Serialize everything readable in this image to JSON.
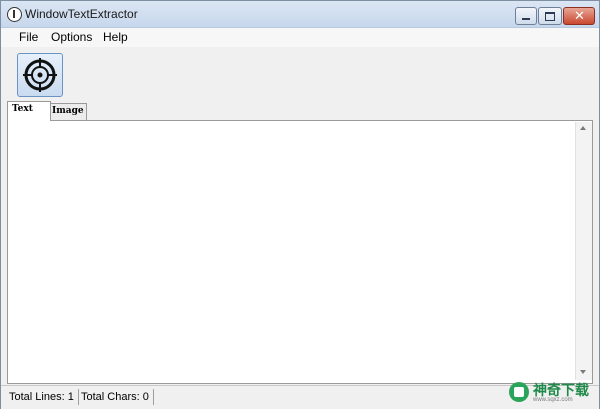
{
  "window": {
    "title": "WindowTextExtractor"
  },
  "menu": {
    "items": [
      "File",
      "Options",
      "Help"
    ]
  },
  "toolbar": {
    "finder_icon": "crosshair-target-icon"
  },
  "tabs": [
    {
      "label": "Text",
      "active": true
    },
    {
      "label": "Image",
      "active": false
    }
  ],
  "content": {
    "text": ""
  },
  "status": {
    "lines": "Total Lines: 1",
    "chars": "Total Chars: 0"
  },
  "watermark": {
    "text": "神奇下载",
    "sub": "www.sqxz.com",
    "color": "#1f8a49"
  },
  "colors": {
    "titlebar_top": "#dbe6f4",
    "titlebar_bottom": "#c7d7ec",
    "close_button": "#c9482f",
    "panel_bg": "#ffffff"
  }
}
